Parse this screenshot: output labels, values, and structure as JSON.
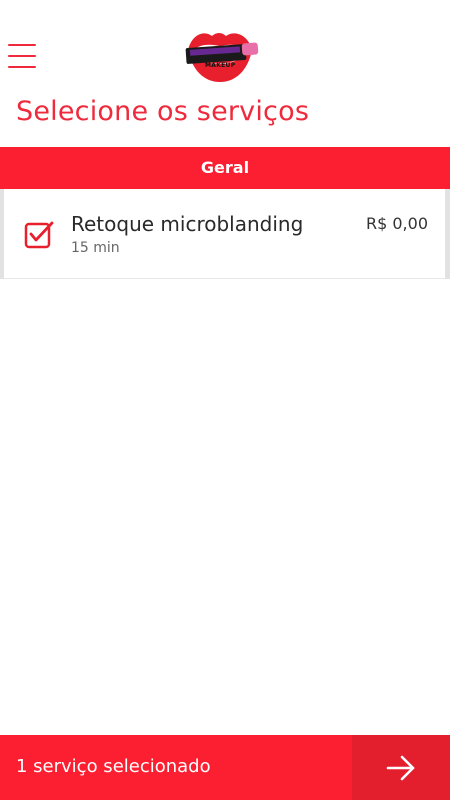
{
  "header": {
    "logo_icon": "lips-lipstick-logo",
    "logo_text": "MAKEUP"
  },
  "page": {
    "title": "Selecione os serviços"
  },
  "section": {
    "label": "Geral"
  },
  "services": [
    {
      "name": "Retoque microblanding",
      "duration": "15 min",
      "price": "R$ 0,00",
      "checked": true
    }
  ],
  "footer": {
    "selected_label": "1 serviço selecionado",
    "next_icon": "arrow-right-icon"
  },
  "colors": {
    "accent": "#fc1f31",
    "accent_dark": "#e31e2d",
    "title": "#ee2a3c"
  }
}
